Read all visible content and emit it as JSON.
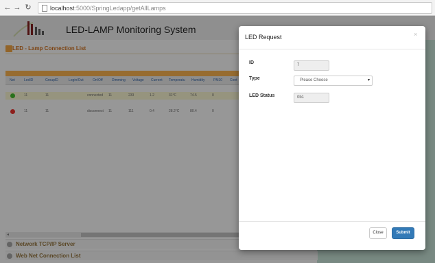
{
  "browser": {
    "host": "localhost",
    "path": ":5000/SpringLedapp/getAllLamps"
  },
  "app": {
    "title": "LED-LAMP Monitoring System",
    "panel_title": "LED - Lamp Connection List",
    "table": {
      "columns": [
        "Net",
        "LedID",
        "GroupID",
        "Login/Out",
        "On/Off",
        "Dimming",
        "Voltage",
        "Current",
        "Temperatu",
        "Humidity",
        "PM10",
        "Cont"
      ],
      "rows": [
        {
          "status_color": "#3fae2a",
          "cells": [
            "11",
            "11",
            "",
            "connected",
            "11",
            "233",
            "1.2",
            "31°C",
            "74.5",
            "0",
            ""
          ]
        },
        {
          "status_color": "#d9302c",
          "cells": [
            "11",
            "11",
            "",
            "disconnect",
            "11",
            "111",
            "0.4",
            "28.2°C",
            "80.4",
            "0",
            ""
          ]
        }
      ]
    },
    "sections": [
      {
        "label": "Network TCP/IP Server"
      },
      {
        "label": "Web Net Connection List"
      }
    ]
  },
  "modal": {
    "title": "LED Request",
    "close_symbol": "×",
    "id_label": "ID",
    "id_value": "7",
    "type_label": "Type",
    "type_selected": "Please Choose",
    "led_status_label": "LED Status",
    "led_status_value": "0b1",
    "close_button": "Close",
    "submit_button": "Submit"
  },
  "colors": {
    "accent_orange": "#e8a64a",
    "primary_button": "#337ab7",
    "status_green": "#3fae2a",
    "status_red": "#d9302c"
  },
  "icons": [
    "back-arrow-icon",
    "forward-arrow-icon",
    "reload-icon",
    "page-icon",
    "logo-icon",
    "panel-icon",
    "network-icon",
    "web-icon",
    "close-icon",
    "chevron-down-icon"
  ]
}
